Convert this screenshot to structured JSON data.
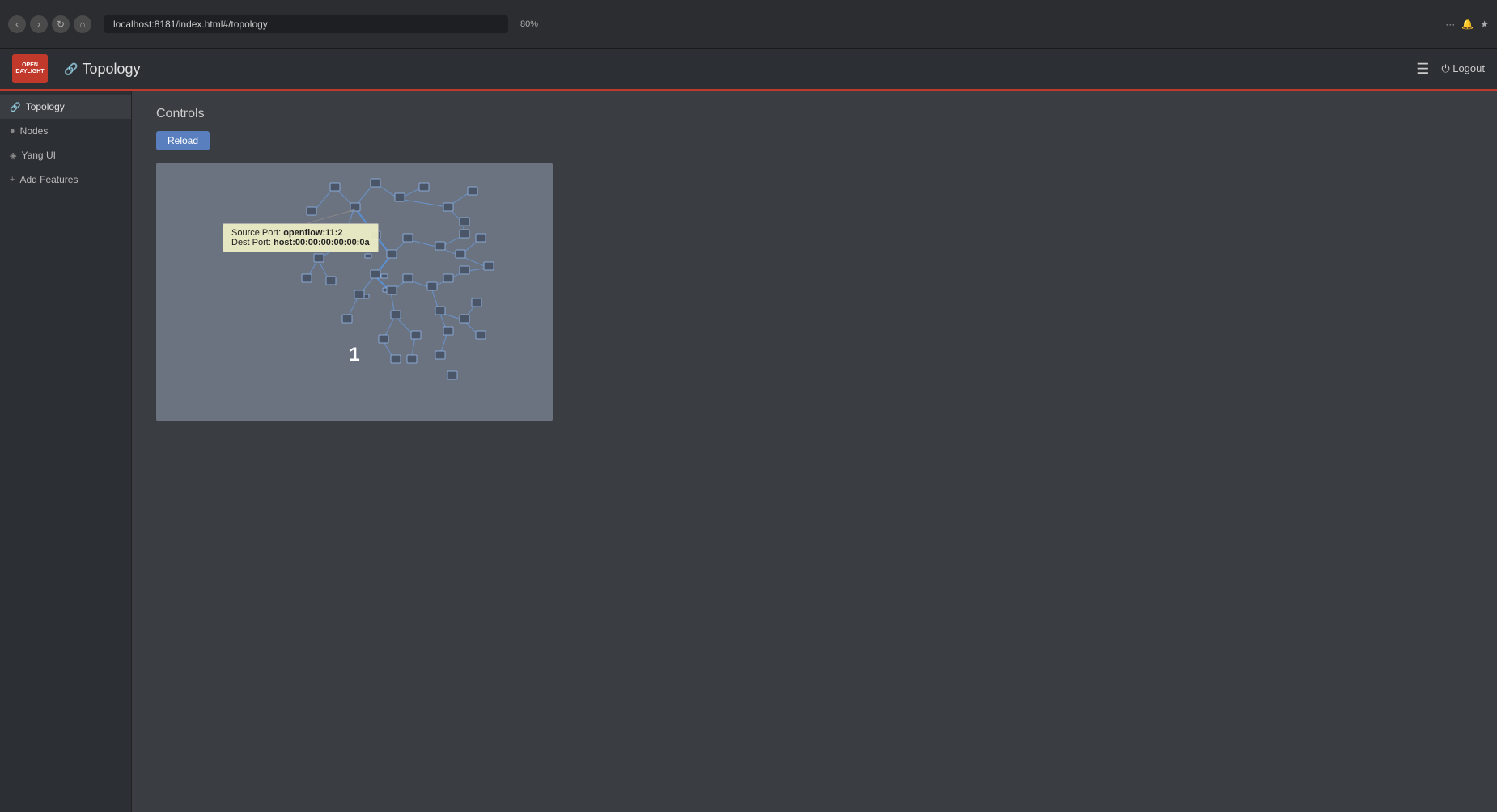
{
  "browser": {
    "address": "localhost:8181/index.html#/topology",
    "zoom": "80%"
  },
  "header": {
    "logo_line1": "OPEN",
    "logo_line2": "DAYLIGHT",
    "page_icon": "🔗",
    "page_title": "Topology",
    "hamburger": "☰",
    "logout_label": "⏻ Logout"
  },
  "sidebar": {
    "items": [
      {
        "label": "Topology",
        "icon": "🔗",
        "active": true
      },
      {
        "label": "Nodes",
        "icon": "●",
        "active": false
      },
      {
        "label": "Yang UI",
        "icon": "◈",
        "active": false
      },
      {
        "label": "Add Features",
        "icon": "+",
        "active": false
      }
    ]
  },
  "controls": {
    "title": "Controls",
    "reload_label": "Reload"
  },
  "topology": {
    "network_number": "1",
    "tooltip": {
      "source_port_label": "Source Port:",
      "source_port_value": "openflow:11:2",
      "dest_port_label": "Dest Port:",
      "dest_port_value": "host:00:00:00:00:00:0a"
    }
  }
}
